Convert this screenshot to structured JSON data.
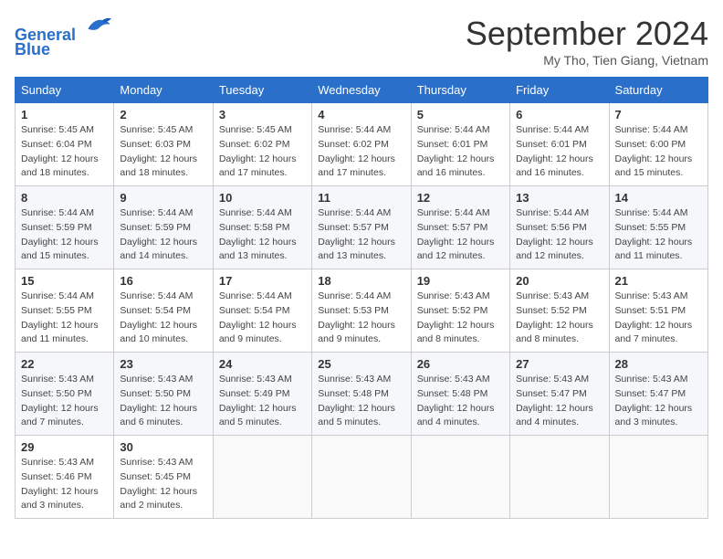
{
  "header": {
    "logo_line1": "General",
    "logo_line2": "Blue",
    "month": "September 2024",
    "location": "My Tho, Tien Giang, Vietnam"
  },
  "weekdays": [
    "Sunday",
    "Monday",
    "Tuesday",
    "Wednesday",
    "Thursday",
    "Friday",
    "Saturday"
  ],
  "weeks": [
    [
      {
        "day": "1",
        "sunrise": "5:45 AM",
        "sunset": "6:04 PM",
        "daylight": "12 hours and 18 minutes."
      },
      {
        "day": "2",
        "sunrise": "5:45 AM",
        "sunset": "6:03 PM",
        "daylight": "12 hours and 18 minutes."
      },
      {
        "day": "3",
        "sunrise": "5:45 AM",
        "sunset": "6:02 PM",
        "daylight": "12 hours and 17 minutes."
      },
      {
        "day": "4",
        "sunrise": "5:44 AM",
        "sunset": "6:02 PM",
        "daylight": "12 hours and 17 minutes."
      },
      {
        "day": "5",
        "sunrise": "5:44 AM",
        "sunset": "6:01 PM",
        "daylight": "12 hours and 16 minutes."
      },
      {
        "day": "6",
        "sunrise": "5:44 AM",
        "sunset": "6:01 PM",
        "daylight": "12 hours and 16 minutes."
      },
      {
        "day": "7",
        "sunrise": "5:44 AM",
        "sunset": "6:00 PM",
        "daylight": "12 hours and 15 minutes."
      }
    ],
    [
      {
        "day": "8",
        "sunrise": "5:44 AM",
        "sunset": "5:59 PM",
        "daylight": "12 hours and 15 minutes."
      },
      {
        "day": "9",
        "sunrise": "5:44 AM",
        "sunset": "5:59 PM",
        "daylight": "12 hours and 14 minutes."
      },
      {
        "day": "10",
        "sunrise": "5:44 AM",
        "sunset": "5:58 PM",
        "daylight": "12 hours and 13 minutes."
      },
      {
        "day": "11",
        "sunrise": "5:44 AM",
        "sunset": "5:57 PM",
        "daylight": "12 hours and 13 minutes."
      },
      {
        "day": "12",
        "sunrise": "5:44 AM",
        "sunset": "5:57 PM",
        "daylight": "12 hours and 12 minutes."
      },
      {
        "day": "13",
        "sunrise": "5:44 AM",
        "sunset": "5:56 PM",
        "daylight": "12 hours and 12 minutes."
      },
      {
        "day": "14",
        "sunrise": "5:44 AM",
        "sunset": "5:55 PM",
        "daylight": "12 hours and 11 minutes."
      }
    ],
    [
      {
        "day": "15",
        "sunrise": "5:44 AM",
        "sunset": "5:55 PM",
        "daylight": "12 hours and 11 minutes."
      },
      {
        "day": "16",
        "sunrise": "5:44 AM",
        "sunset": "5:54 PM",
        "daylight": "12 hours and 10 minutes."
      },
      {
        "day": "17",
        "sunrise": "5:44 AM",
        "sunset": "5:54 PM",
        "daylight": "12 hours and 9 minutes."
      },
      {
        "day": "18",
        "sunrise": "5:44 AM",
        "sunset": "5:53 PM",
        "daylight": "12 hours and 9 minutes."
      },
      {
        "day": "19",
        "sunrise": "5:43 AM",
        "sunset": "5:52 PM",
        "daylight": "12 hours and 8 minutes."
      },
      {
        "day": "20",
        "sunrise": "5:43 AM",
        "sunset": "5:52 PM",
        "daylight": "12 hours and 8 minutes."
      },
      {
        "day": "21",
        "sunrise": "5:43 AM",
        "sunset": "5:51 PM",
        "daylight": "12 hours and 7 minutes."
      }
    ],
    [
      {
        "day": "22",
        "sunrise": "5:43 AM",
        "sunset": "5:50 PM",
        "daylight": "12 hours and 7 minutes."
      },
      {
        "day": "23",
        "sunrise": "5:43 AM",
        "sunset": "5:50 PM",
        "daylight": "12 hours and 6 minutes."
      },
      {
        "day": "24",
        "sunrise": "5:43 AM",
        "sunset": "5:49 PM",
        "daylight": "12 hours and 5 minutes."
      },
      {
        "day": "25",
        "sunrise": "5:43 AM",
        "sunset": "5:48 PM",
        "daylight": "12 hours and 5 minutes."
      },
      {
        "day": "26",
        "sunrise": "5:43 AM",
        "sunset": "5:48 PM",
        "daylight": "12 hours and 4 minutes."
      },
      {
        "day": "27",
        "sunrise": "5:43 AM",
        "sunset": "5:47 PM",
        "daylight": "12 hours and 4 minutes."
      },
      {
        "day": "28",
        "sunrise": "5:43 AM",
        "sunset": "5:47 PM",
        "daylight": "12 hours and 3 minutes."
      }
    ],
    [
      {
        "day": "29",
        "sunrise": "5:43 AM",
        "sunset": "5:46 PM",
        "daylight": "12 hours and 3 minutes."
      },
      {
        "day": "30",
        "sunrise": "5:43 AM",
        "sunset": "5:45 PM",
        "daylight": "12 hours and 2 minutes."
      },
      null,
      null,
      null,
      null,
      null
    ]
  ]
}
